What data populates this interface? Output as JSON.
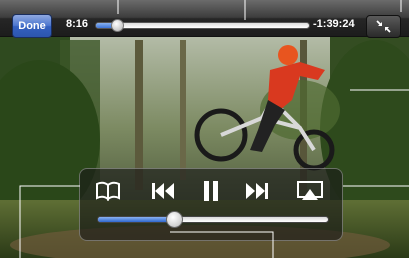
{
  "topbar": {
    "done_label": "Done",
    "elapsed": "8:16",
    "remaining": "-1:39:24",
    "playback_progress": 0.1
  },
  "controls": {
    "icons": [
      "chapters-icon",
      "previous-track-icon",
      "pause-icon",
      "next-track-icon",
      "airplay-icon"
    ],
    "volume_level": 0.33
  },
  "colors": {
    "accent_blue": "#3c74d9",
    "done_button": "#3461c0"
  }
}
